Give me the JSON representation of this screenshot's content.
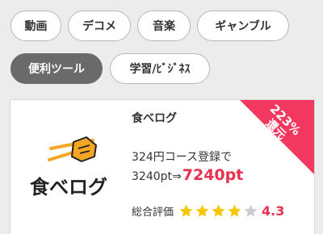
{
  "categories": {
    "row1": [
      "動画",
      "デコメ",
      "音楽",
      "ギャンブル"
    ],
    "row2": [
      "便利ツール",
      "学習/ﾋﾞｼﾞﾈｽ"
    ],
    "active": "便利ツール"
  },
  "offer": {
    "shop_name": "食べログ",
    "logo_text": "食べログ",
    "badge_percent": "223%",
    "badge_label": "還元",
    "description_line1": "324円コース登録で",
    "points_base": "3240pt⇒",
    "points_total": "7240pt",
    "rating_label": "総合評価",
    "rating_value": "4.3",
    "stars_filled": 4,
    "stars_total": 5
  },
  "colors": {
    "accent": "#e8304f",
    "star_filled": "#f7c600",
    "star_empty": "#cccccc",
    "active_tab": "#6a6a6a",
    "ribbon": "#f2385e"
  }
}
